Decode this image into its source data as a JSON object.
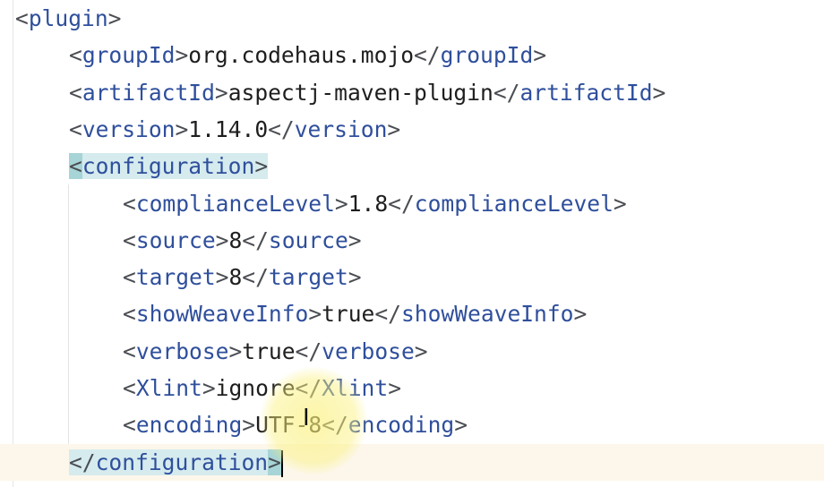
{
  "editor": {
    "language": "xml",
    "lines": [
      {
        "indent": 0,
        "open": "plugin",
        "text": "",
        "close": ""
      },
      {
        "indent": 1,
        "open": "groupId",
        "text": "org.codehaus.mojo",
        "close": "groupId"
      },
      {
        "indent": 1,
        "open": "artifactId",
        "text": "aspectj-maven-plugin",
        "close": "artifactId"
      },
      {
        "indent": 1,
        "open": "version",
        "text": "1.14.0",
        "close": "version"
      },
      {
        "indent": 1,
        "open": "configuration",
        "text": "",
        "close": "",
        "highlight": true
      },
      {
        "indent": 2,
        "open": "complianceLevel",
        "text": "1.8",
        "close": "complianceLevel"
      },
      {
        "indent": 2,
        "open": "source",
        "text": "8",
        "close": "source"
      },
      {
        "indent": 2,
        "open": "target",
        "text": "8",
        "close": "target"
      },
      {
        "indent": 2,
        "open": "showWeaveInfo",
        "text": "true",
        "close": "showWeaveInfo"
      },
      {
        "indent": 2,
        "open": "verbose",
        "text": "true",
        "close": "verbose"
      },
      {
        "indent": 2,
        "open": "Xlint",
        "text": "ignore",
        "close": "Xlint"
      },
      {
        "indent": 2,
        "open": "encoding",
        "text": "UTF-8",
        "close": "encoding"
      },
      {
        "indent": 1,
        "open": "",
        "text": "",
        "close": "configuration",
        "highlight": true,
        "caret": true
      }
    ]
  },
  "colors": {
    "tag": "#2f4f9c",
    "bracket": "#4a4d52",
    "text": "#1e1e1e",
    "match_highlight": "#d5ebee",
    "current_line": "#fcf7ea"
  },
  "icons": {
    "cursor": "text-cursor-icon"
  }
}
